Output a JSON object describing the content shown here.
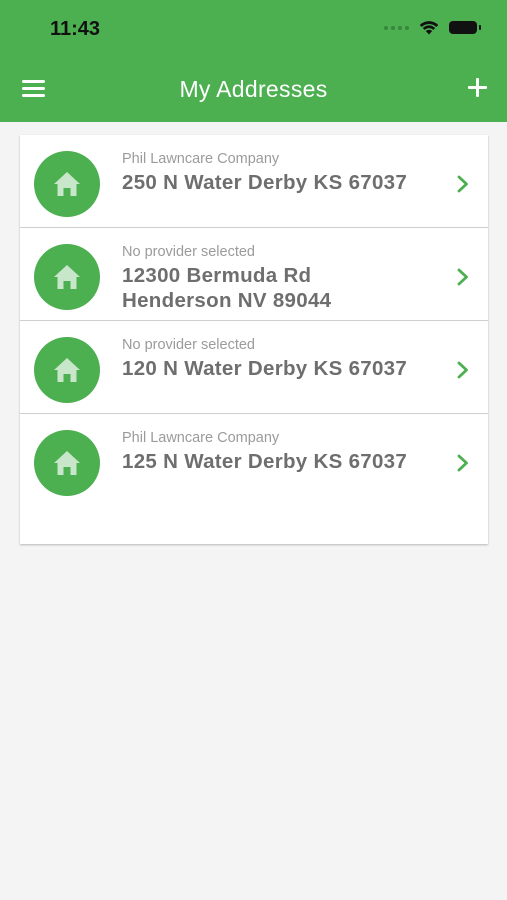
{
  "status_bar": {
    "time": "11:43"
  },
  "header": {
    "title": "My Addresses"
  },
  "addresses": [
    {
      "provider": "Phil Lawncare Company",
      "address": "250 N Water Derby KS 67037"
    },
    {
      "provider": "No provider selected",
      "address": "12300 Bermuda Rd Henderson NV 89044"
    },
    {
      "provider": "No provider selected",
      "address": "120 N Water Derby KS 67037"
    },
    {
      "provider": "Phil Lawncare Company",
      "address": "125 N Water Derby KS 67037"
    }
  ],
  "icons": {
    "menu": "hamburger-menu-icon",
    "add": "plus-icon",
    "home": "house-icon",
    "chevron": "chevron-right-icon"
  },
  "colors": {
    "brand_green": "#4caf50",
    "background": "#f4f4f4",
    "card": "#ffffff",
    "text_muted": "#9b9b9b",
    "text_address": "#6e6e6e",
    "home_glyph": "#c8e6c9"
  }
}
